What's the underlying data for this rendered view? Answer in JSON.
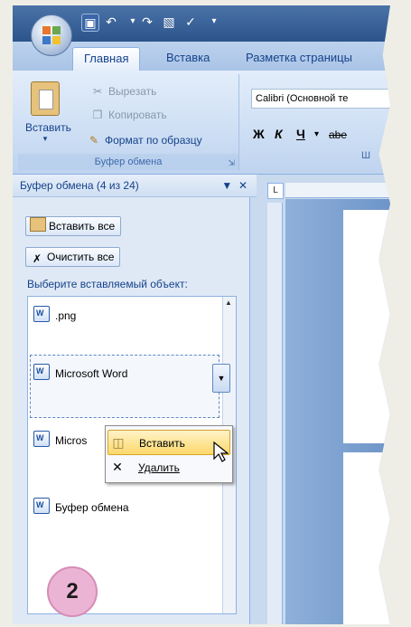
{
  "ribbon": {
    "tabs": [
      {
        "label": "Главная",
        "active": true
      },
      {
        "label": "Вставка",
        "active": false
      },
      {
        "label": "Разметка страницы",
        "active": false
      }
    ],
    "clipboard_group": {
      "paste_label": "Вставить",
      "cut_label": "Вырезать",
      "copy_label": "Копировать",
      "format_painter_label": "Формат по образцу",
      "group_label": "Буфер обмена"
    },
    "font_group": {
      "font_name": "Calibri (Основной те",
      "bold": "Ж",
      "italic": "К",
      "underline": "Ч",
      "strikethrough": "abe",
      "group_label_partial": "Ш"
    }
  },
  "clipboard_pane": {
    "title": "Буфер обмена (4 из 24)",
    "paste_all_label": "Вставить все",
    "clear_all_label": "Очистить все",
    "pick_label": "Выберите вставляемый объект:",
    "items": [
      {
        "label": ".png"
      },
      {
        "label": "Microsoft Word"
      },
      {
        "label": "Micros"
      },
      {
        "label": "Буфер обмена"
      }
    ]
  },
  "context_menu": {
    "items": [
      {
        "label": "Вставить",
        "highlighted": true
      },
      {
        "label": "Удалить",
        "highlighted": false
      }
    ]
  },
  "step_badge": "2",
  "colors": {
    "accent_orange": "#e8772e",
    "ribbon_blue": "#c9d9ee",
    "highlight_yellow": "#fbd96b",
    "badge_pink": "#ecb4d4"
  }
}
